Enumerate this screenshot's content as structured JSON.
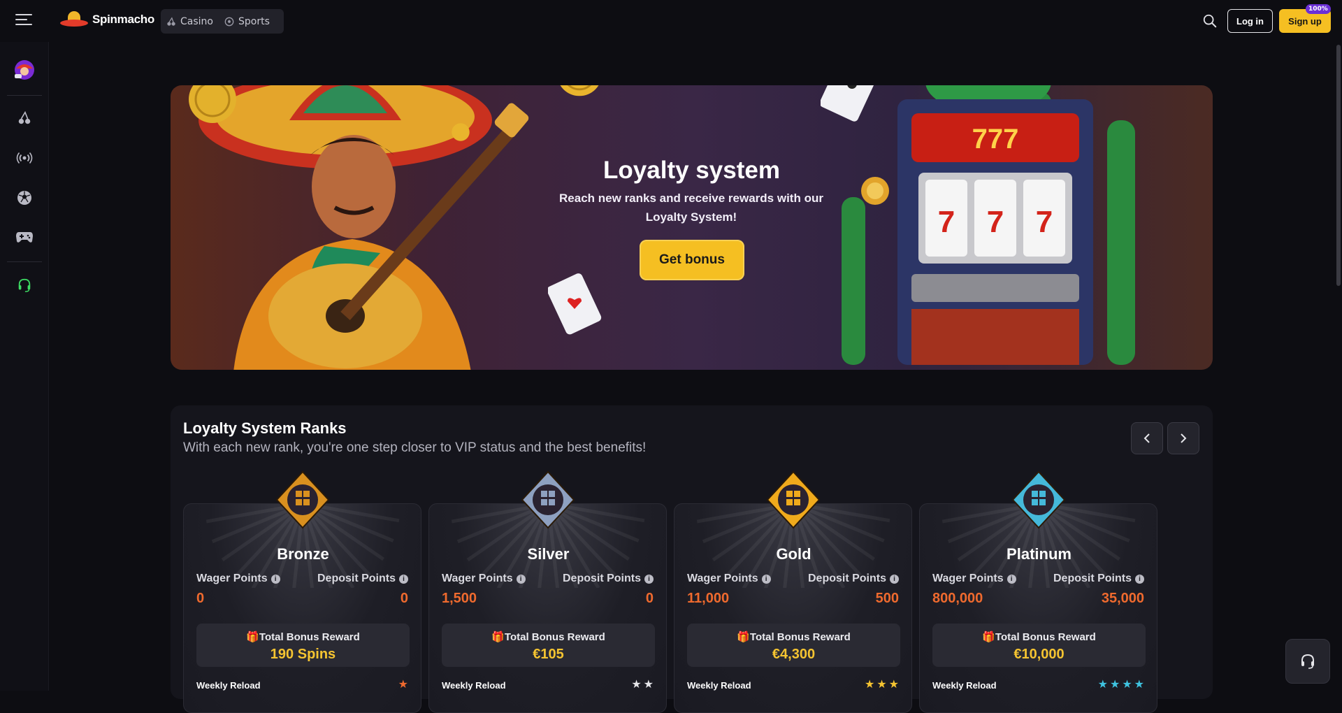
{
  "header": {
    "brand": "Spinmacho",
    "nav": [
      {
        "label": "Casino",
        "icon": "cherry-icon"
      },
      {
        "label": "Sports",
        "icon": "soccer-ball-icon"
      }
    ],
    "login_label": "Log in",
    "signup_label": "Sign up",
    "signup_badge": "100%"
  },
  "sidebar": {
    "items": [
      {
        "icon": "promo-avatar-icon"
      },
      {
        "icon": "cherry-icon"
      },
      {
        "icon": "live-broadcast-icon"
      },
      {
        "icon": "soccer-ball-icon"
      },
      {
        "icon": "gamepad-icon"
      },
      {
        "icon": "support-headset-icon"
      }
    ]
  },
  "hero": {
    "title": "Loyalty system",
    "subtitle": "Reach new ranks and receive rewards with our Loyalty System!",
    "button_label": "Get bonus"
  },
  "ranks": {
    "title": "Loyalty System Ranks",
    "subtitle": "With each new rank, you're one step closer to VIP status and the best benefits!",
    "wager_label": "Wager Points",
    "deposit_label": "Deposit Points",
    "bonus_label": "Total Bonus Reward",
    "weekly_label": "Weekly Reload",
    "cards": [
      {
        "name": "Bronze",
        "wager": "0",
        "deposit": "0",
        "bonus": "190 Spins",
        "stars": 1,
        "star_color": "#ef6a2e",
        "emblem_color": "#d9901f"
      },
      {
        "name": "Silver",
        "wager": "1,500",
        "deposit": "0",
        "bonus": "€105",
        "stars": 2,
        "star_color": "#e6e6ea",
        "emblem_color": "#8ea0c0"
      },
      {
        "name": "Gold",
        "wager": "11,000",
        "deposit": "500",
        "bonus": "€4,300",
        "stars": 3,
        "star_color": "#f5c431",
        "emblem_color": "#f0aa1c"
      },
      {
        "name": "Platinum",
        "wager": "800,000",
        "deposit": "35,000",
        "bonus": "€10,000",
        "stars": 4,
        "star_color": "#3fc3e0",
        "emblem_color": "#45b8da"
      }
    ]
  },
  "colors": {
    "accent": "#f5bf22",
    "points": "#ef6a2e",
    "bonus": "#f5c431",
    "support": "#3ddc63"
  }
}
